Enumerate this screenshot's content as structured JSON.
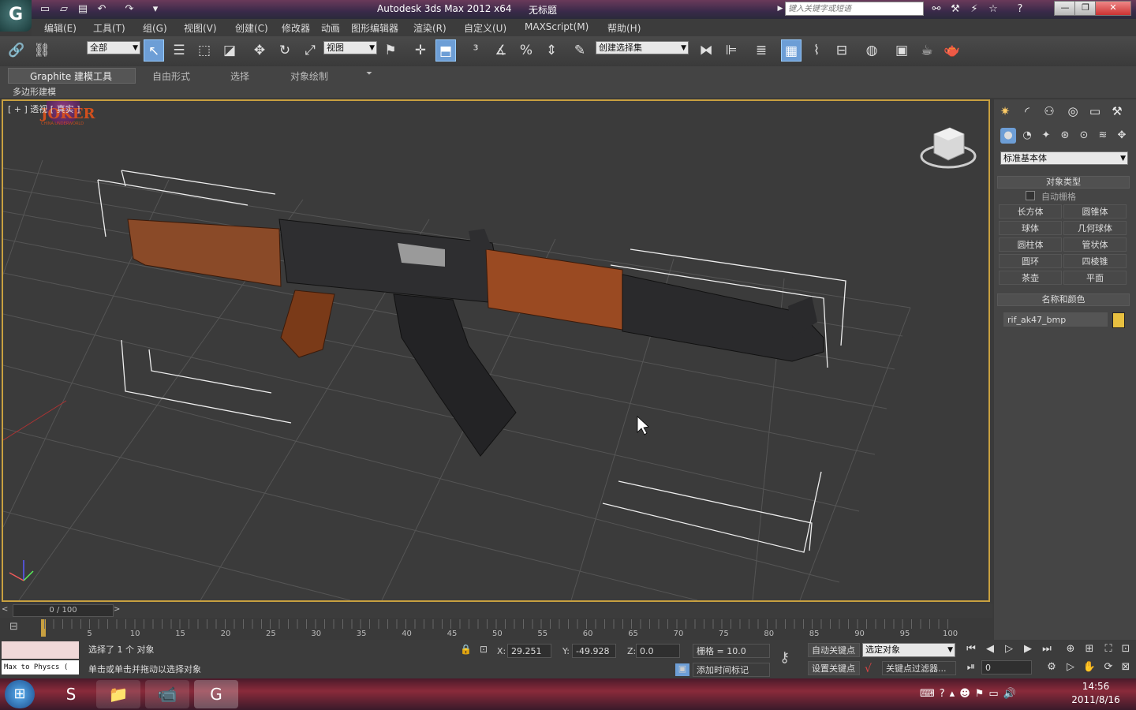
{
  "window": {
    "title": "Autodesk 3ds Max  2012 x64",
    "doc_title": "无标题",
    "search_placeholder": "键入关键字或短语",
    "minimize": "—",
    "restore": "❐",
    "close": "✕"
  },
  "menu": {
    "items": [
      "编辑(E)",
      "工具(T)",
      "组(G)",
      "视图(V)",
      "创建(C)",
      "修改器",
      "动画",
      "图形编辑器",
      "渲染(R)",
      "自定义(U)",
      "MAXScript(M)",
      "帮助(H)"
    ]
  },
  "toolbar": {
    "filter_dropdown": "全部",
    "ref_coord_dropdown": "视图",
    "selection_set_dropdown": "创建选择集"
  },
  "ribbon": {
    "tabs": [
      "Graphite 建模工具",
      "自由形式",
      "选择",
      "对象绘制"
    ],
    "sub_label": "多边形建模"
  },
  "viewport": {
    "label": "[ + ] 透视 [ 真实 ]",
    "logo_text": "JOKER",
    "logo_sub": "CHINA.UNDERWORLD"
  },
  "command_panel": {
    "category_dropdown": "标准基本体",
    "object_type_header": "对象类型",
    "auto_grid_label": "自动栅格",
    "object_buttons": [
      "长方体",
      "圆锥体",
      "球体",
      "几何球体",
      "圆柱体",
      "管状体",
      "圆环",
      "四棱锥",
      "茶壶",
      "平面"
    ],
    "name_color_header": "名称和颜色",
    "object_name": "rif_ak47_bmp",
    "object_color": "#e8c040"
  },
  "timeline": {
    "slider_text": "0 / 100",
    "ticks": [
      "0",
      "5",
      "10",
      "15",
      "20",
      "25",
      "30",
      "35",
      "40",
      "45",
      "50",
      "55",
      "60",
      "65",
      "70",
      "75",
      "80",
      "85",
      "90",
      "95",
      "100"
    ]
  },
  "status": {
    "script_listener": "Max to Physcs (",
    "selection_info": "选择了 1 个 对象",
    "prompt": "单击或单击并拖动以选择对象",
    "x_label": "X:",
    "x_value": "29.251",
    "y_label": "Y:",
    "y_value": "-49.928",
    "z_label": "Z:",
    "z_value": "0.0",
    "grid": "栅格 = 10.0",
    "add_time_tag": "添加时间标记",
    "auto_key": "自动关键点",
    "set_key": "设置关键点",
    "key_mode_dropdown": "选定对象",
    "key_filters": "关键点过滤器...",
    "frame_value": "0"
  },
  "taskbar": {
    "time": "14:56",
    "date": "2011/8/16"
  }
}
